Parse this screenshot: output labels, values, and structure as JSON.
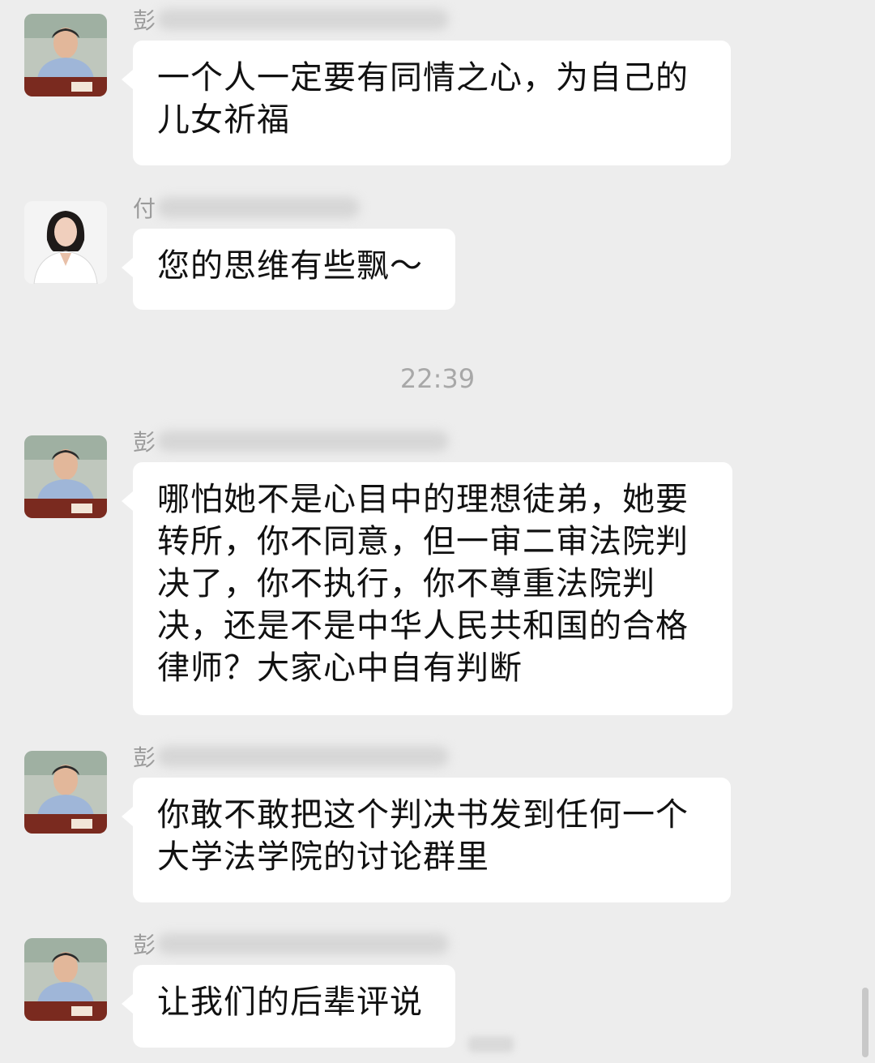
{
  "chat": {
    "messages": [
      {
        "sender_visible": "彭",
        "avatar": "man-avatar",
        "text": "一个人一定要有同情之心，为自己的\n儿女祈福"
      },
      {
        "sender_visible": "付",
        "avatar": "woman-avatar",
        "text": "您的思维有些飘～"
      },
      {
        "sender_visible": "彭",
        "avatar": "man-avatar",
        "text": "哪怕她不是心目中的理想徒弟，她要\n转所，你不同意，但一审二审法院判\n决了，你不执行，你不尊重法院判\n决，还是不是中华人民共和国的合格\n律师？大家心中自有判断"
      },
      {
        "sender_visible": "彭",
        "avatar": "man-avatar",
        "text": "你敢不敢把这个判决书发到任何一个\n大学法学院的讨论群里"
      },
      {
        "sender_visible": "彭",
        "avatar": "man-avatar",
        "text": "让我们的后辈评说"
      }
    ],
    "timestamp": "22:39"
  },
  "colors": {
    "background": "#ededed",
    "bubble": "#ffffff",
    "sender_text": "#9a9a9a",
    "timestamp_text": "#a8a8a8"
  }
}
